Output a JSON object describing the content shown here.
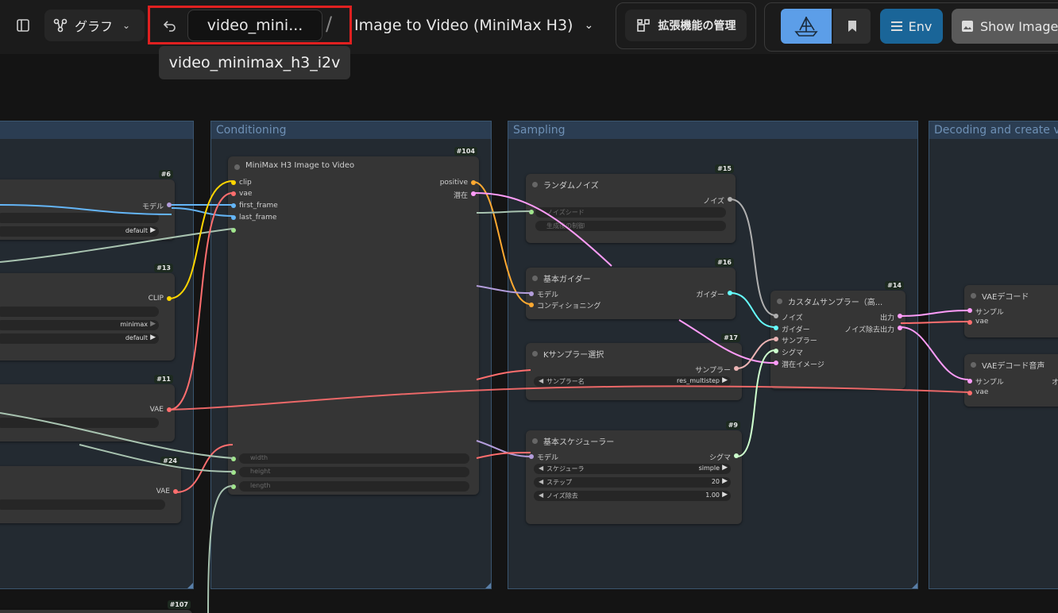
{
  "topbar": {
    "graph_label": "グラフ",
    "workflow_short": "video_mini...",
    "separator": "/",
    "workflow_title": "Image to Video (MiniMax H3)",
    "tooltip": "video_minimax_h3_i2v",
    "extensions_label": "拡張機能の管理",
    "env_label": "Env",
    "show_image_label": "Show Image"
  },
  "groups": {
    "conditioning": "Conditioning",
    "sampling": "Sampling",
    "decoding": "Decoding and create v"
  },
  "left_nodes": {
    "n6": {
      "id": "#6",
      "out": "モデル",
      "val": "default"
    },
    "n13": {
      "id": "#13",
      "out": "CLIP",
      "val1": "minimax",
      "val2": "default"
    },
    "n11": {
      "id": "#11",
      "out": "VAE"
    },
    "n24": {
      "id": "#24",
      "out": "VAE"
    },
    "n107": {
      "id": "#107"
    }
  },
  "n104": {
    "id": "#104",
    "title": "MiniMax H3 Image to Video",
    "in_clip": "clip",
    "in_vae": "vae",
    "in_first": "first_frame",
    "in_last": "last_frame",
    "out_pos": "positive",
    "out_lat": "潜在",
    "w_width": "width",
    "w_height": "height",
    "w_length": "length"
  },
  "n15": {
    "id": "#15",
    "title": "ランダムノイズ",
    "out": "ノイズ",
    "w_seed": "ノイズシード",
    "w_ctrl": "生成後の制御"
  },
  "n16": {
    "id": "#16",
    "title": "基本ガイダー",
    "in_model": "モデル",
    "in_cond": "コンディショニング",
    "out": "ガイダー"
  },
  "n17": {
    "id": "#17",
    "title": "Kサンプラー選択",
    "out": "サンプラー",
    "w_label": "サンプラー名",
    "w_val": "res_multistep"
  },
  "n9": {
    "id": "#9",
    "title": "基本スケジューラー",
    "in_model": "モデル",
    "out": "シグマ",
    "w1_label": "スケジューラ",
    "w1_val": "simple",
    "w2_label": "ステップ",
    "w2_val": "20",
    "w3_label": "ノイズ除去",
    "w3_val": "1.00"
  },
  "n14": {
    "id": "#14",
    "title": "カスタムサンプラー（高...",
    "in_noise": "ノイズ",
    "in_guider": "ガイダー",
    "in_sampler": "サンプラー",
    "in_sigma": "シグマ",
    "in_latent": "潜在イメージ",
    "out1": "出力",
    "out2": "ノイズ除去出力"
  },
  "vae_decode": {
    "title": "VAEデコード",
    "in_sample": "サンプル",
    "in_vae": "vae"
  },
  "vae_audio": {
    "title": "VAEデコード音声",
    "in_sample": "サンプル",
    "in_vae": "vae",
    "out_cut": "オ"
  },
  "colors": {
    "model": "#b39ddb",
    "clip": "#ffd500",
    "vae": "#ff6e6e",
    "image": "#64b5f6",
    "latent": "#ff9cf9",
    "cond": "#ffa931",
    "noise": "#b0b0b0",
    "guider": "#66ffff",
    "sampler": "#ecb4b4",
    "sigma": "#cdffcd",
    "int": "#a1e68c",
    "highlight": "#e02020"
  }
}
